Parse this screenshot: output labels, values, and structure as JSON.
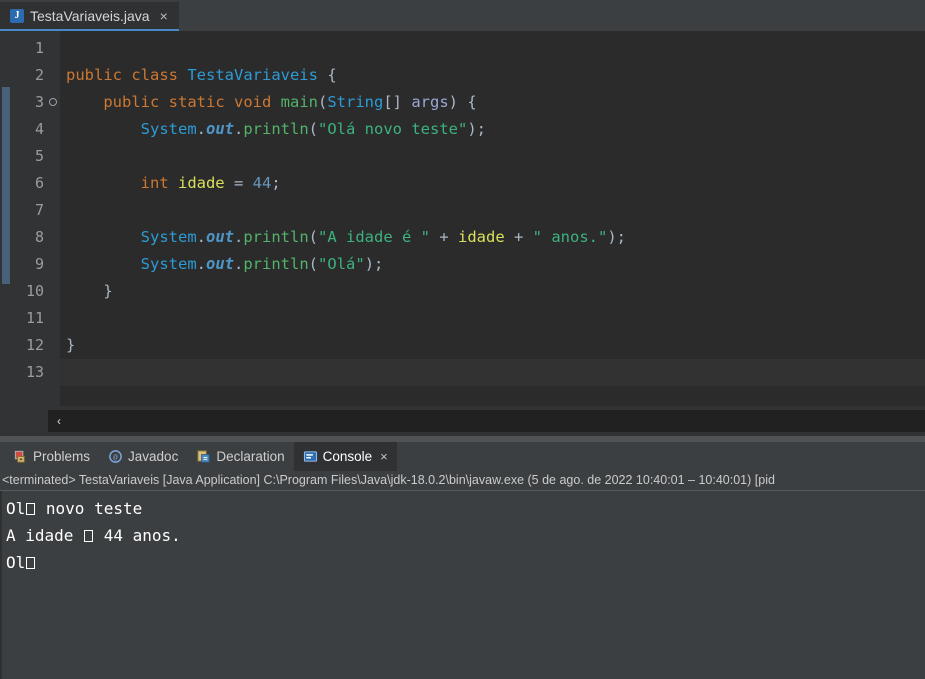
{
  "editor_tab": {
    "filename": "TestaVariaveis.java",
    "icon": "java-file-icon",
    "close": "×"
  },
  "editor": {
    "line_numbers": [
      "1",
      "2",
      "3",
      "4",
      "5",
      "6",
      "7",
      "8",
      "9",
      "10",
      "11",
      "12",
      "13"
    ],
    "marker_line": 3,
    "current_line": 13,
    "lines": [
      {
        "n": "1",
        "tokens": []
      },
      {
        "n": "2",
        "tokens": [
          {
            "t": "public ",
            "c": "kw"
          },
          {
            "t": "class ",
            "c": "kw"
          },
          {
            "t": "TestaVariaveis",
            "c": "type"
          },
          {
            "t": " {",
            "c": "pl"
          }
        ]
      },
      {
        "n": "3",
        "tokens": [
          {
            "t": "    ",
            "c": "pl"
          },
          {
            "t": "public ",
            "c": "kw"
          },
          {
            "t": "static ",
            "c": "kw"
          },
          {
            "t": "void ",
            "c": "kw"
          },
          {
            "t": "main",
            "c": "fn"
          },
          {
            "t": "(",
            "c": "pl"
          },
          {
            "t": "String",
            "c": "type"
          },
          {
            "t": "[] ",
            "c": "pl"
          },
          {
            "t": "args",
            "c": "id"
          },
          {
            "t": ") {",
            "c": "pl"
          }
        ]
      },
      {
        "n": "4",
        "tokens": [
          {
            "t": "        ",
            "c": "pl"
          },
          {
            "t": "System",
            "c": "type"
          },
          {
            "t": ".",
            "c": "pl"
          },
          {
            "t": "out",
            "c": "fld"
          },
          {
            "t": ".",
            "c": "pl"
          },
          {
            "t": "println",
            "c": "fn"
          },
          {
            "t": "(",
            "c": "pl"
          },
          {
            "t": "\"Olá novo teste\"",
            "c": "str"
          },
          {
            "t": ");",
            "c": "pl"
          }
        ]
      },
      {
        "n": "5",
        "tokens": []
      },
      {
        "n": "6",
        "tokens": [
          {
            "t": "        ",
            "c": "pl"
          },
          {
            "t": "int ",
            "c": "kw"
          },
          {
            "t": "idade ",
            "c": "var"
          },
          {
            "t": "= ",
            "c": "pl"
          },
          {
            "t": "44",
            "c": "num"
          },
          {
            "t": ";",
            "c": "pl"
          }
        ]
      },
      {
        "n": "7",
        "tokens": []
      },
      {
        "n": "8",
        "tokens": [
          {
            "t": "        ",
            "c": "pl"
          },
          {
            "t": "System",
            "c": "type"
          },
          {
            "t": ".",
            "c": "pl"
          },
          {
            "t": "out",
            "c": "fld"
          },
          {
            "t": ".",
            "c": "pl"
          },
          {
            "t": "println",
            "c": "fn"
          },
          {
            "t": "(",
            "c": "pl"
          },
          {
            "t": "\"A idade é \"",
            "c": "str"
          },
          {
            "t": " + ",
            "c": "pl"
          },
          {
            "t": "idade",
            "c": "var"
          },
          {
            "t": " + ",
            "c": "pl"
          },
          {
            "t": "\" anos.\"",
            "c": "str"
          },
          {
            "t": ");",
            "c": "pl"
          }
        ]
      },
      {
        "n": "9",
        "tokens": [
          {
            "t": "        ",
            "c": "pl"
          },
          {
            "t": "System",
            "c": "type"
          },
          {
            "t": ".",
            "c": "pl"
          },
          {
            "t": "out",
            "c": "fld"
          },
          {
            "t": ".",
            "c": "pl"
          },
          {
            "t": "println",
            "c": "fn"
          },
          {
            "t": "(",
            "c": "pl"
          },
          {
            "t": "\"Olá\"",
            "c": "str"
          },
          {
            "t": ");",
            "c": "pl"
          }
        ]
      },
      {
        "n": "10",
        "tokens": [
          {
            "t": "    }",
            "c": "pl"
          }
        ]
      },
      {
        "n": "11",
        "tokens": []
      },
      {
        "n": "12",
        "tokens": [
          {
            "t": "}",
            "c": "pl"
          }
        ]
      },
      {
        "n": "13",
        "tokens": []
      }
    ]
  },
  "scrollbar": {
    "left_arrow": "‹"
  },
  "bottom_panel": {
    "tabs": [
      {
        "label": "Problems",
        "icon": "problems-icon",
        "active": false,
        "closable": false
      },
      {
        "label": "Javadoc",
        "icon": "javadoc-icon",
        "active": false,
        "closable": false
      },
      {
        "label": "Declaration",
        "icon": "declaration-icon",
        "active": false,
        "closable": false
      },
      {
        "label": "Console",
        "icon": "console-icon",
        "active": true,
        "closable": true
      }
    ],
    "close_glyph": "×",
    "status": "<terminated> TestaVariaveis [Java Application] C:\\Program Files\\Java\\jdk-18.0.2\\bin\\javaw.exe  (5 de ago. de 2022 10:40:01 – 10:40:01) [pid",
    "console_output": [
      {
        "parts": [
          {
            "t": "Ol",
            "tofu": false
          },
          {
            "t": "",
            "tofu": true
          },
          {
            "t": " novo teste",
            "tofu": false
          }
        ]
      },
      {
        "parts": [
          {
            "t": "A idade ",
            "tofu": false
          },
          {
            "t": "",
            "tofu": true
          },
          {
            "t": " 44 anos.",
            "tofu": false
          }
        ]
      },
      {
        "parts": [
          {
            "t": "Ol",
            "tofu": false
          },
          {
            "t": "",
            "tofu": true
          }
        ]
      }
    ]
  },
  "colors": {
    "editor_bg": "#2b2b2b",
    "gutter_bg": "#313335",
    "panel_bg": "#3c3f41",
    "tab_active_bg": "#2f3133",
    "accent": "#4a88c7",
    "keyword": "#cc7832",
    "type": "#2d9bd4",
    "method": "#53b36b",
    "string": "#3cb27e",
    "variable": "#d9e05c",
    "number": "#6897bb",
    "plain": "#a9b7c6",
    "change_bar": "#4a6a85"
  }
}
